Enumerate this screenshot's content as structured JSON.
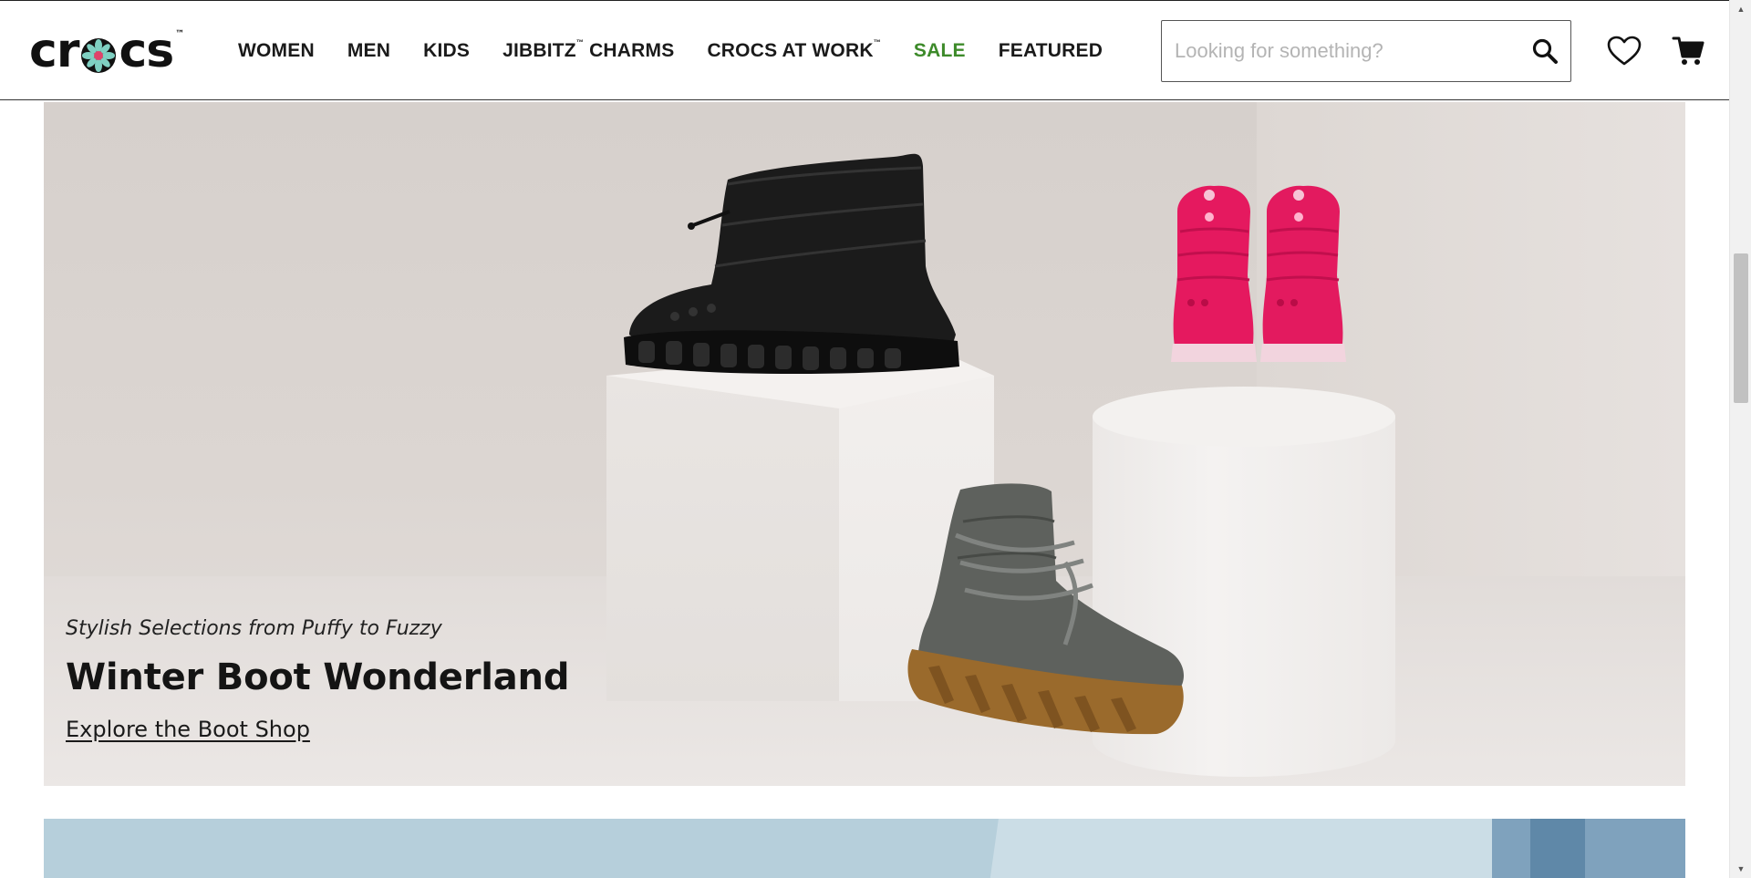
{
  "brand": {
    "logo_text_left": "cr",
    "logo_text_right": "cs",
    "logo_tm": "™"
  },
  "nav": {
    "items": [
      {
        "label": "WOMEN"
      },
      {
        "label": "MEN"
      },
      {
        "label": "KIDS"
      },
      {
        "label": "JIBBITZ",
        "tm": "™",
        "suffix": " CHARMS"
      },
      {
        "label": "CROCS AT WORK",
        "tm": "™"
      },
      {
        "label": "SALE"
      },
      {
        "label": "FEATURED"
      }
    ]
  },
  "search": {
    "placeholder": "Looking for something?",
    "value": ""
  },
  "icons": {
    "search": "search-icon",
    "wishlist": "heart-icon",
    "cart": "cart-icon"
  },
  "hero": {
    "kicker": "Stylish Selections from Puffy to Fuzzy",
    "title": "Winter Boot Wonderland",
    "cta": "Explore the Boot Shop"
  },
  "colors": {
    "sale": "#3d8a2a",
    "text": "#1a1a1a",
    "pink_boot": "#e5195f",
    "black_boot": "#1c1c1c",
    "gray_boot": "#5f625e",
    "gum_sole": "#9a6a2c"
  }
}
